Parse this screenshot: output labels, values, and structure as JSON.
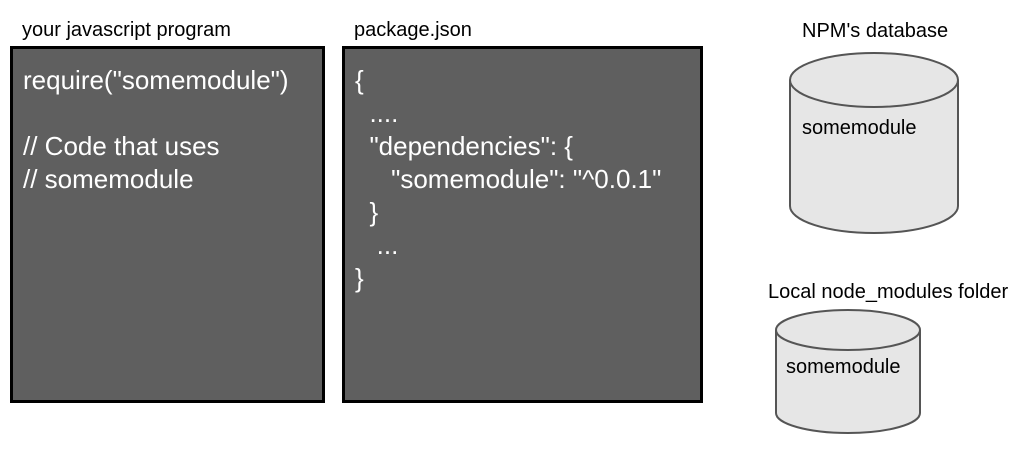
{
  "colors": {
    "panel_fill": "#5f5f5f",
    "panel_border": "#000000",
    "panel_text": "#ffffff",
    "cylinder_fill": "#e6e6e6",
    "cylinder_stroke": "#555555"
  },
  "program": {
    "title": "your javascript program",
    "lines": [
      "require(\"somemodule\")",
      "",
      "// Code that uses",
      "// somemodule"
    ]
  },
  "package": {
    "title": "package.json",
    "lines": [
      "{",
      "  ....",
      "  \"dependencies\": {",
      "     \"somemodule\": \"^0.0.1\"",
      "  }",
      "   ...",
      "}"
    ]
  },
  "npm_db": {
    "title": "NPM's database",
    "item": "somemodule"
  },
  "local_folder": {
    "title": "Local node_modules folder",
    "item": "somemodule"
  }
}
